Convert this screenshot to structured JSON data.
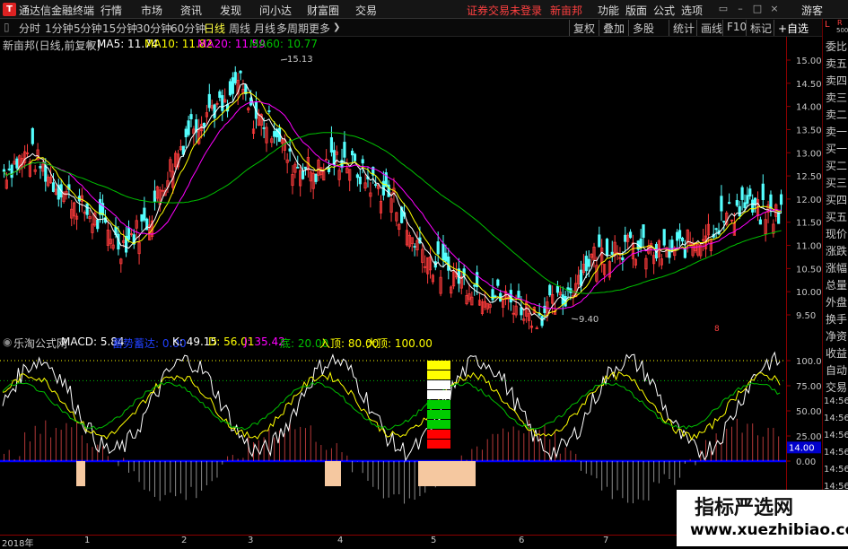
{
  "menubar": {
    "app_name": "通达信金融终端",
    "menus": [
      "行情",
      "市场",
      "资讯",
      "发现",
      "问小达",
      "财富圈",
      "交易"
    ],
    "login_warning": "证券交易未登录",
    "stock_name": "新亩邦",
    "right_menus": [
      "功能",
      "版面",
      "公式",
      "选项"
    ],
    "guest": "游客"
  },
  "toolbar": {
    "periods": [
      "分时",
      "1分钟",
      "5分钟",
      "15分钟",
      "30分钟",
      "60分钟",
      "日线",
      "周线",
      "月线",
      "多周期",
      "更多"
    ],
    "active_period": "日线",
    "right_buttons": [
      "复权",
      "叠加",
      "多股",
      "统计",
      "画线",
      "F10",
      "标记",
      "+自选"
    ]
  },
  "main_info": {
    "title": "新亩邦(日线,前复权)",
    "ma5": "MA5: 11.74",
    "ma10": "MA10: 11.82",
    "ma20": "MA20: 11.59",
    "ma60": "MA60: 10.77",
    "high_label": "15.13",
    "low_label": "9.40",
    "mark": "8"
  },
  "price_axis": [
    "15.00",
    "14.50",
    "14.00",
    "13.50",
    "13.00",
    "12.50",
    "12.00",
    "11.50",
    "11.00",
    "10.50",
    "10.00",
    "9.50"
  ],
  "indicator_info": {
    "title": "乐淘公式网",
    "macd": "MACD: 5.84",
    "label2": "蓄势蓄达: 0.00",
    "k": "K: 49.15",
    "d": "D: 56.01",
    "j": "J: 35.42",
    "bottom": "底: 20.00",
    "entry": "入顶: 80.00",
    "top": "大顶: 100.00"
  },
  "indicator_axis": [
    "100.00",
    "75.00",
    "50.00",
    "25.00",
    "0.00"
  ],
  "indicator_current": "14.00",
  "sidepanel": {
    "top_labels": [
      "L",
      "R",
      "500"
    ],
    "items": [
      "委比",
      "卖五",
      "卖四",
      "卖三",
      "卖二",
      "卖一",
      "买一",
      "买二",
      "买三",
      "买四",
      "买五",
      "现价",
      "涨跌",
      "涨幅",
      "总量",
      "外盘",
      "换手",
      "净资",
      "收益",
      "自动",
      "交易",
      "14:56",
      "14:56",
      "14:56",
      "14:56",
      "14:56",
      "14:56",
      "14:56",
      "14:56"
    ]
  },
  "date_axis": [
    "2018年",
    "1",
    "2",
    "3",
    "4",
    "5",
    "6",
    "7"
  ],
  "watermark": {
    "line1": "指标严选网",
    "line2": "www.xuezhibiao.com"
  },
  "colors": {
    "up": "#ff3c3c",
    "down": "#54ffff",
    "ma5": "#ffffff",
    "ma10": "#ffff00",
    "ma20": "#ff00ff",
    "ma60": "#00c000",
    "axis": "#8b0000"
  }
}
